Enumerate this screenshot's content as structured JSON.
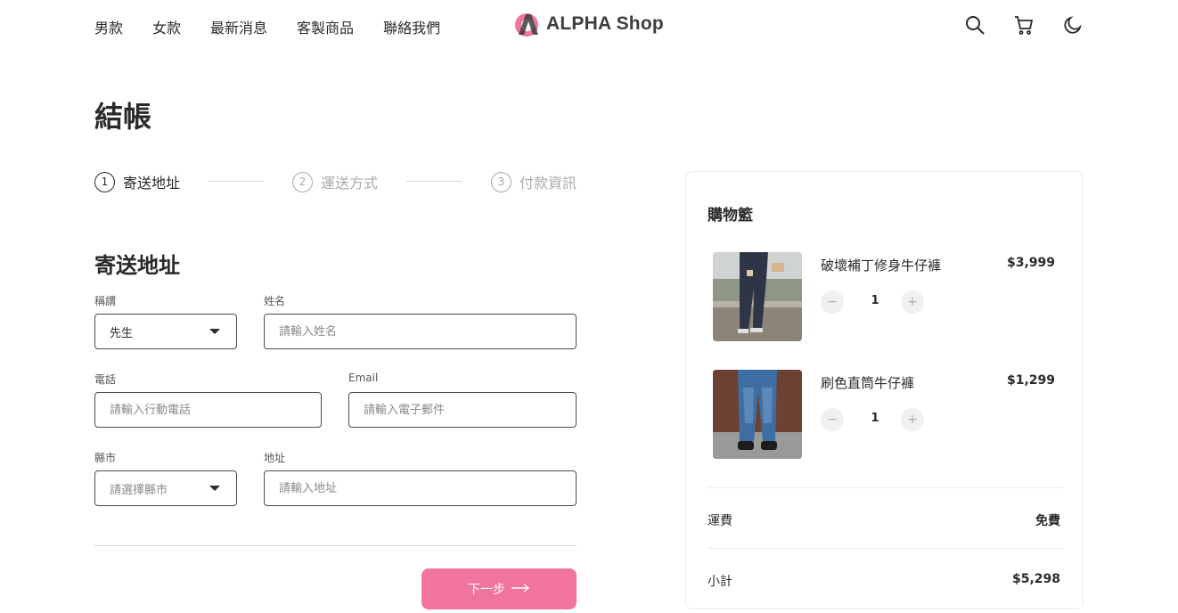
{
  "nav": {
    "items": [
      "男款",
      "女款",
      "最新消息",
      "客製商品",
      "聯絡我們"
    ]
  },
  "brand": {
    "name": "ALPHA Shop",
    "accent": "#f0749b"
  },
  "header_icons": [
    "search-icon",
    "cart-icon",
    "moon-icon"
  ],
  "page": {
    "title": "結帳"
  },
  "stepper": {
    "steps": [
      {
        "num": "1",
        "label": "寄送地址"
      },
      {
        "num": "2",
        "label": "運送方式"
      },
      {
        "num": "3",
        "label": "付款資訊"
      }
    ]
  },
  "form": {
    "section_title": "寄送地址",
    "salutation": {
      "label": "稱謂",
      "value": "先生"
    },
    "name": {
      "label": "姓名",
      "placeholder": "請輸入姓名"
    },
    "phone": {
      "label": "電話",
      "placeholder": "請輸入行動電話"
    },
    "email": {
      "label": "Email",
      "placeholder": "請輸入電子郵件"
    },
    "city": {
      "label": "縣市",
      "placeholder": "請選擇縣市"
    },
    "address": {
      "label": "地址",
      "placeholder": "請輸入地址"
    },
    "next_label": "下一步"
  },
  "cart": {
    "title": "購物籃",
    "items": [
      {
        "name": "破壞補丁修身牛仔褲",
        "price": "$3,999",
        "qty": "1"
      },
      {
        "name": "刷色直筒牛仔褲",
        "price": "$1,299",
        "qty": "1"
      }
    ],
    "shipping_label": "運費",
    "shipping_value": "免費",
    "subtotal_label": "小計",
    "subtotal_value": "$5,298"
  }
}
